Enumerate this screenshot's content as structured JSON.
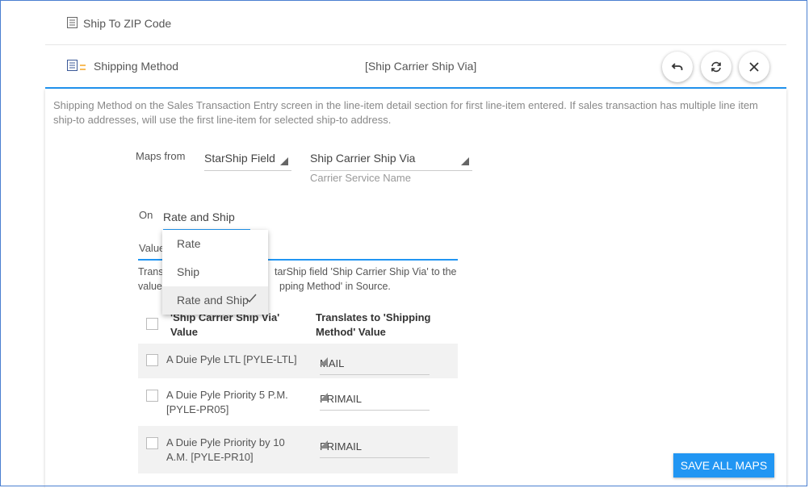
{
  "rows": {
    "ship_to_zip": {
      "label": "Ship To ZIP Code"
    },
    "shipping_method": {
      "label": "Shipping Method",
      "mapped_value": "[Ship Carrier Ship Via]"
    }
  },
  "icons": {
    "list": "list-icon",
    "warning": "warning-icon",
    "undo": "undo-icon",
    "refresh": "refresh-icon",
    "close": "close-icon",
    "check": "check-icon",
    "dropdown": "triangle-icon"
  },
  "colors": {
    "accent": "#2196f3",
    "warning": "#f5a623",
    "frame": "#4a7fd1"
  },
  "panel": {
    "description": "Shipping Method on the Sales Transaction Entry screen in the line-item detail section for first line-item entered. If sales transaction has multiple line item ship-to addresses, will use the first line-item for selected ship-to address.",
    "maps_from_label": "Maps from",
    "source_type": "StarShip Field",
    "source_field": "Ship Carrier Ship Via",
    "source_helper": "Carrier Service Name",
    "on_label": "On",
    "on_value": "Rate and Ship",
    "value_label": "Value",
    "translate_text_line1": "Trans",
    "translate_text_line1_rest": "tarShip field 'Ship Carrier Ship Via' to the",
    "translate_text_line2": "value",
    "translate_text_line2_rest": "pping Method' in Source.",
    "dropdown": {
      "options": [
        "Rate",
        "Ship",
        "Rate and Ship"
      ],
      "selected": "Rate and Ship"
    },
    "table": {
      "col1_header_line1": "'Ship Carrier Ship Via'",
      "col1_header_line2": "Value",
      "col2_header_line1": "Translates to 'Shipping",
      "col2_header_line2": "Method' Value",
      "rows": [
        {
          "source": "A Duie Pyle LTL [PYLE-LTL]",
          "target": "MAIL"
        },
        {
          "source": "A Duie Pyle Priority 5 P.M. [PYLE-PR05]",
          "target": "PRIMAIL"
        },
        {
          "source": "A Duie Pyle Priority by 10 A.M. [PYLE-PR10]",
          "target": "PRIMAIL"
        }
      ]
    }
  },
  "save_all_label": "SAVE ALL MAPS"
}
